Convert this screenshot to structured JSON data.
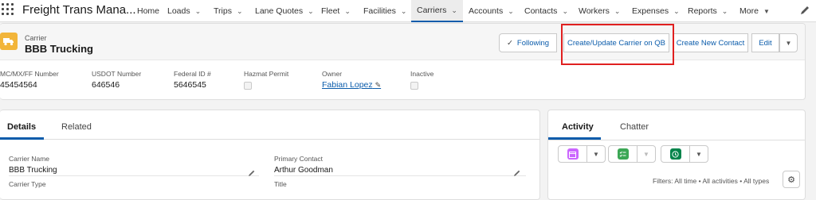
{
  "app": {
    "name": "Freight Trans Mana..."
  },
  "nav": {
    "items": [
      {
        "label": "Home",
        "chevron": false
      },
      {
        "label": "Loads",
        "chevron": true
      },
      {
        "label": "Trips",
        "chevron": true
      },
      {
        "label": "Lane Quotes",
        "chevron": true
      },
      {
        "label": "Fleet",
        "chevron": true
      },
      {
        "label": "Facilities",
        "chevron": true
      },
      {
        "label": "Carriers",
        "chevron": true,
        "active": true
      },
      {
        "label": "Accounts",
        "chevron": true
      },
      {
        "label": "Contacts",
        "chevron": true
      },
      {
        "label": "Workers",
        "chevron": true
      },
      {
        "label": "Expenses",
        "chevron": true
      },
      {
        "label": "Reports",
        "chevron": true
      },
      {
        "label": "More",
        "chevron": true
      }
    ]
  },
  "record": {
    "type": "Carrier",
    "title": "BBB Trucking",
    "icon": "truck-icon",
    "accent": "#f2b53a",
    "actions": {
      "following": "Following",
      "create_qb": "Create/Update Carrier on QB",
      "new_contact": "Create New Contact",
      "edit": "Edit"
    },
    "fields": [
      {
        "label": "MC/MX/FF Number",
        "value": "45454564"
      },
      {
        "label": "USDOT Number",
        "value": "646546"
      },
      {
        "label": "Federal ID #",
        "value": "5646545"
      },
      {
        "label": "Hazmat Permit",
        "checkbox": true
      },
      {
        "label": "Owner",
        "value": "Fabian Lopez",
        "link": true
      },
      {
        "label": "Inactive",
        "checkbox": true
      }
    ]
  },
  "details": {
    "tabs": [
      "Details",
      "Related"
    ],
    "fields": {
      "carrier_name": {
        "label": "Carrier Name",
        "value": "BBB Trucking"
      },
      "primary_contact": {
        "label": "Primary Contact",
        "value": "Arthur Goodman"
      },
      "carrier_type": {
        "label": "Carrier Type"
      },
      "title": {
        "label": "Title"
      }
    }
  },
  "activity": {
    "tabs": [
      "Activity",
      "Chatter"
    ],
    "filters": "Filters: All time • All activities • All types",
    "colors": {
      "event": "#cb65ff",
      "task": "#3ba755",
      "call": "#04844b"
    }
  }
}
